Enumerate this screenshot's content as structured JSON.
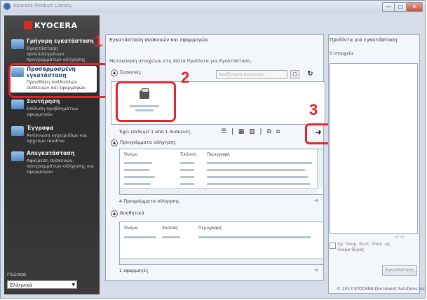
{
  "window": {
    "title": "Kyocera Product Library",
    "controls": [
      "—",
      "▢",
      "✕"
    ]
  },
  "brand": {
    "logo_text": "KYOCERA",
    "accent": "#d52b1e"
  },
  "sidebar": {
    "items": [
      {
        "title": "Γρήγορη εγκατάσταση",
        "desc": "Εγκατάσταση προεπιλεγμένων προγραμμάτων οδήγησης"
      },
      {
        "title": "Προσαρμοσμένη εγκατάσταση",
        "desc": "Προσθήκη πολλαπλών συσκευών και εφαρμογών"
      },
      {
        "title": "Συντήρηση",
        "desc": "Επίλυση προβλημάτων εφαρμογών"
      },
      {
        "title": "Έγγραφα",
        "desc": "Ανάγνωση εγχειριδίων και αρχείων readme"
      },
      {
        "title": "Απεγκατάσταση",
        "desc": "Αφαίρεση συσκευών, προγραμμάτων οδήγησης και εφαρμογών"
      }
    ],
    "language_label": "Γλώσσα",
    "language_value": "Ελληνικά"
  },
  "annotations": {
    "step1": "1",
    "step2": "2",
    "step3": "3",
    "highlight_color": "#e0262d"
  },
  "main": {
    "heading": "Εγκατάσταση συσκευών και εφαρμογών",
    "instruction": "Μετακίνηση στοιχείων στη λίστα Προϊόντα για Εγκατάσταση.",
    "devices": {
      "label": "Συσκευές",
      "search_placeholder": "Αναζήτηση συσκευών",
      "refresh_icon": "↻",
      "count": "Έχει επιλεγεί 1 από 1 συσκευές",
      "arrow": "➜"
    },
    "drivers": {
      "label": "Προγράμματα οδήγησης",
      "columns": [
        "Όνομα",
        "Έκδοση",
        "Περιγραφή"
      ],
      "count": "4 Προγράμματα οδήγησης"
    },
    "utilities": {
      "label": "Βοηθητικά",
      "columns": [
        "Όνομα",
        "Έκδοση",
        "Περιγραφή"
      ],
      "count": "1 εφαρμογές"
    }
  },
  "right": {
    "title": "Προϊόντα για εγκατάσταση",
    "count": "0 στοιχεία",
    "checkbox_label": "Χρ. Όνομ. Κεντ. Υπολ. ως όνομα θύρας",
    "install_button": "Εγκατάσταση",
    "pager": "⇨ ⇨"
  },
  "footer": {
    "copyright": "© 2013 KYOCERA Document Solutions Inc."
  }
}
